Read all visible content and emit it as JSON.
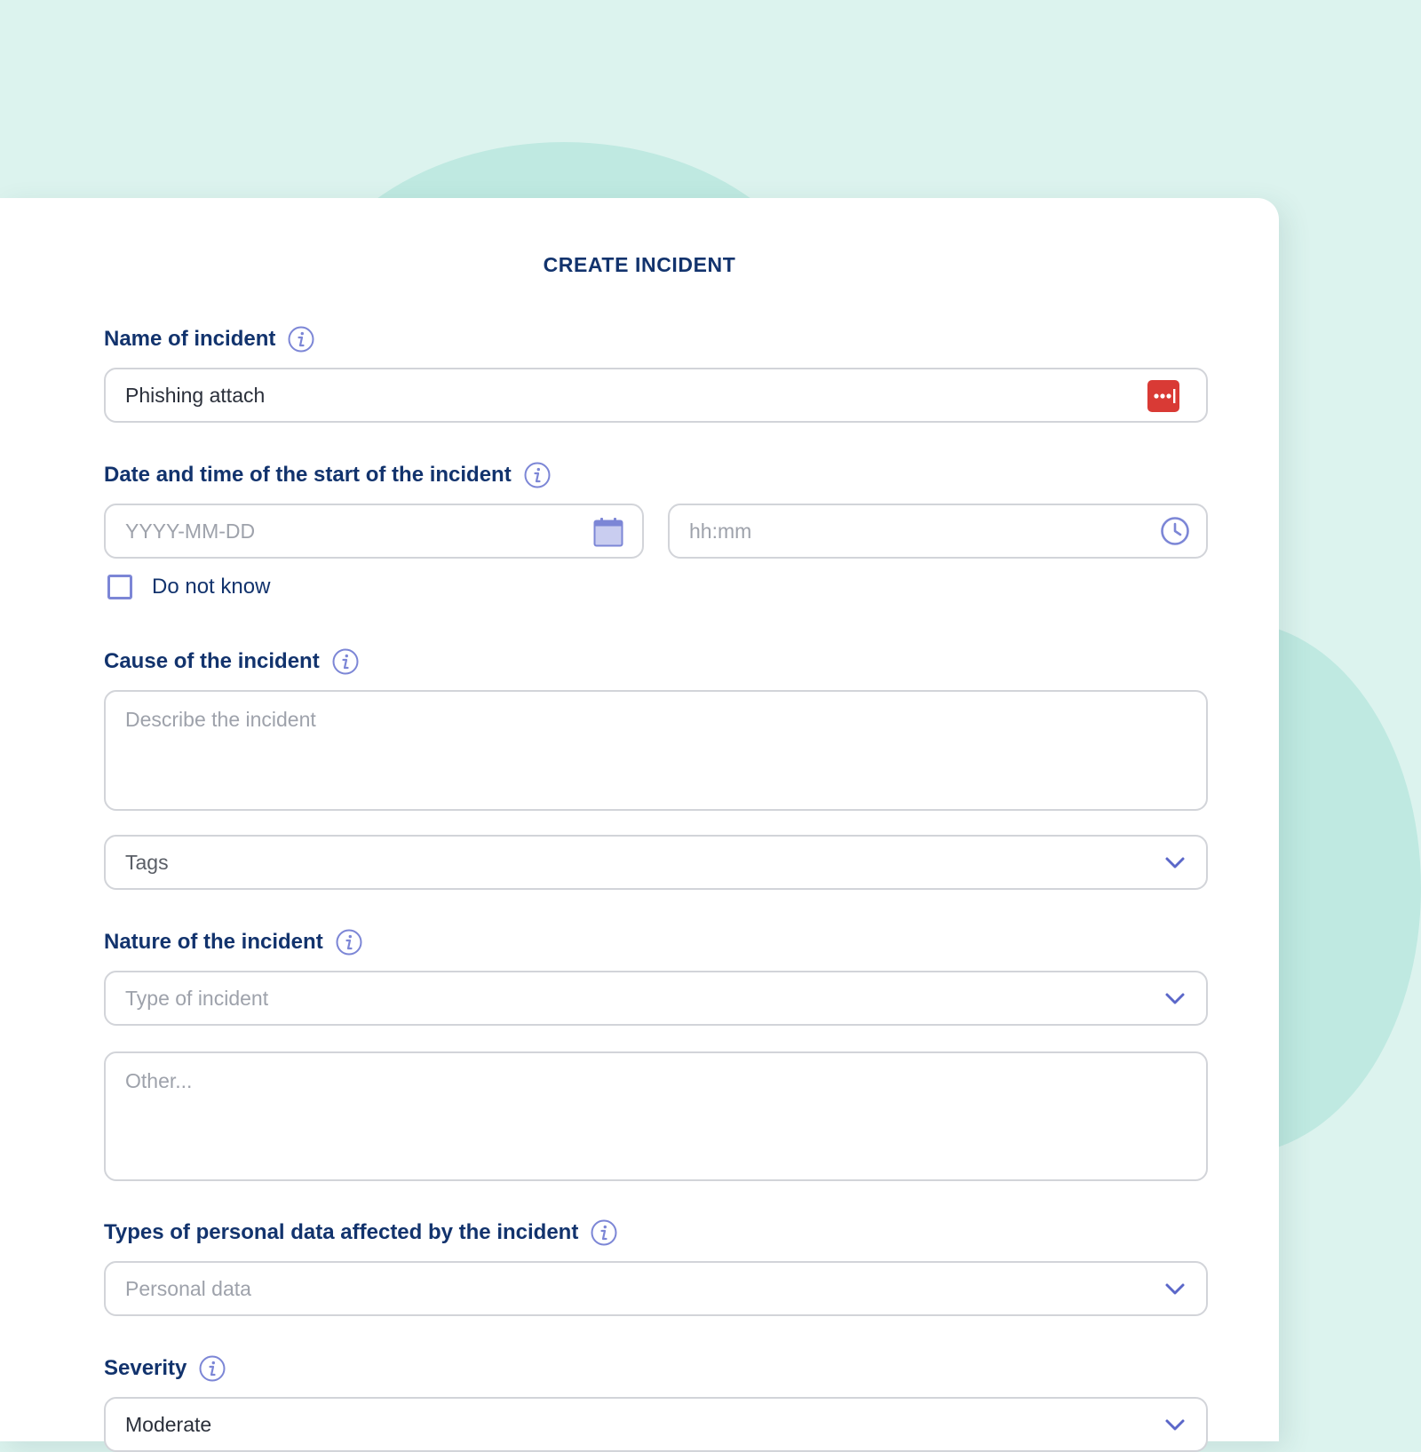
{
  "form": {
    "title": "CREATE INCIDENT",
    "name": {
      "label": "Name of incident",
      "value": "Phishing attach",
      "info_icon": "info-icon",
      "field_icon": "password-manager-icon"
    },
    "datetime": {
      "label": "Date and time of the start of the incident",
      "date_placeholder": "YYYY-MM-DD",
      "time_placeholder": "hh:mm",
      "date_icon": "calendar-icon",
      "time_icon": "clock-icon",
      "checkbox_label": "Do not know",
      "checkbox_checked": false
    },
    "cause": {
      "label": "Cause of the incident",
      "placeholder": "Describe the incident",
      "tags_placeholder": "Tags"
    },
    "nature": {
      "label": "Nature of the incident",
      "type_placeholder": "Type of incident",
      "other_placeholder": "Other..."
    },
    "personal_data": {
      "label": "Types of personal data affected by the incident",
      "placeholder": "Personal data"
    },
    "severity": {
      "label": "Severity",
      "value": "Moderate"
    }
  },
  "colors": {
    "background": "#dcf3ee",
    "blob": "#bfe9e1",
    "label": "#12336d",
    "accent": "#7c86d6",
    "password_manager": "#d93a35"
  }
}
